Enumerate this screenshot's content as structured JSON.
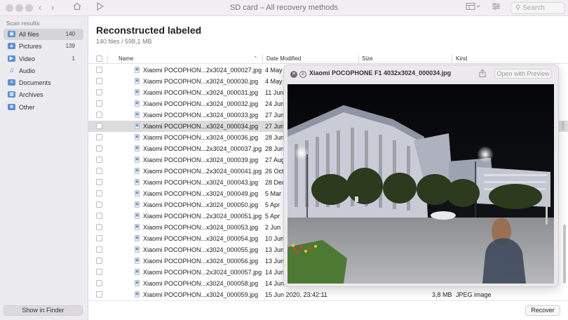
{
  "window": {
    "title": "SD card – All recovery methods",
    "search_placeholder": "Search"
  },
  "sidebar": {
    "section": "Scan results",
    "items": [
      {
        "label": "All files",
        "count": "140",
        "icon": "all-files-icon",
        "selected": true
      },
      {
        "label": "Pictures",
        "count": "139",
        "icon": "pictures-icon"
      },
      {
        "label": "Video",
        "count": "1",
        "icon": "video-icon"
      },
      {
        "label": "Audio",
        "count": "",
        "icon": "audio-icon"
      },
      {
        "label": "Documents",
        "count": "",
        "icon": "documents-icon"
      },
      {
        "label": "Archives",
        "count": "",
        "icon": "archives-icon"
      },
      {
        "label": "Other",
        "count": "",
        "icon": "other-icon"
      }
    ],
    "finder_button": "Show in Finder"
  },
  "main": {
    "heading": "Reconstructed labeled",
    "subheading": "140 files / 598,1 MB",
    "columns": {
      "name": "Name",
      "date": "Date Modified",
      "size": "Size",
      "kind": "Kind"
    },
    "rows": [
      {
        "name": "Xiaomi POCOPHON...2x3024_000027.jpg",
        "date": "4 May",
        "size": "",
        "kind": ""
      },
      {
        "name": "Xiaomi POCOPHON...x3024_000030.jpg",
        "date": "4 May",
        "size": "",
        "kind": ""
      },
      {
        "name": "Xiaomi POCOPHON...x3024_000031.jpg",
        "date": "11 Jun",
        "size": "",
        "kind": ""
      },
      {
        "name": "Xiaomi POCOPHON...x3024_000032.jpg",
        "date": "24 Jun",
        "size": "",
        "kind": ""
      },
      {
        "name": "Xiaomi POCOPHON...x3024_000033.jpg",
        "date": "27 Jun",
        "size": "",
        "kind": ""
      },
      {
        "name": "Xiaomi POCOPHON...x3024_000034.jpg",
        "date": "27 Jun",
        "size": "",
        "kind": "",
        "selected": true
      },
      {
        "name": "Xiaomi POCOPHON...x3024_000036.jpg",
        "date": "28 Jun",
        "size": "",
        "kind": ""
      },
      {
        "name": "Xiaomi POCOPHON...2x3024_000037.jpg",
        "date": "28 Jun",
        "size": "",
        "kind": ""
      },
      {
        "name": "Xiaomi POCOPHON...x3024_000039.jpg",
        "date": "27 Aug",
        "size": "",
        "kind": ""
      },
      {
        "name": "Xiaomi POCOPHON...2x3024_000041.jpg",
        "date": "26 Oct",
        "size": "",
        "kind": ""
      },
      {
        "name": "Xiaomi POCOPHON...x3024_000043.jpg",
        "date": "28 Dec",
        "size": "",
        "kind": ""
      },
      {
        "name": "Xiaomi POCOPHON...x3024_000049.jpg",
        "date": "5 Mar",
        "size": "",
        "kind": ""
      },
      {
        "name": "Xiaomi POCOPHON...x3024_000050.jpg",
        "date": "5 Apr",
        "size": "",
        "kind": ""
      },
      {
        "name": "Xiaomi POCOPHON...2x3024_000051.jpg",
        "date": "5 Apr",
        "size": "",
        "kind": ""
      },
      {
        "name": "Xiaomi POCOPHON...x3024_000053.jpg",
        "date": "2 Jun",
        "size": "",
        "kind": ""
      },
      {
        "name": "Xiaomi POCOPHON...x3024_000054.jpg",
        "date": "10 Jun",
        "size": "",
        "kind": ""
      },
      {
        "name": "Xiaomi POCOPHON...x3024_000055.jpg",
        "date": "13 Jun",
        "size": "",
        "kind": ""
      },
      {
        "name": "Xiaomi POCOPHON...x3024_000056.jpg",
        "date": "13 Jun",
        "size": "",
        "kind": ""
      },
      {
        "name": "Xiaomi POCOPHON...2x3024_000057.jpg",
        "date": "14 Jun",
        "size": "",
        "kind": ""
      },
      {
        "name": "Xiaomi POCOPHON...x3024_000058.jpg",
        "date": "14 Jun",
        "size": "",
        "kind": ""
      },
      {
        "name": "Xiaomi POCOPHON...x3024_000059.jpg",
        "date": "15 Jun 2020, 23:42:11",
        "size": "3,8 MB",
        "kind": "JPEG image"
      }
    ],
    "recover_button": "Recover"
  },
  "preview": {
    "title": "Xiaomi POCOPHONE F1 4032x3024_000034.jpg",
    "open_button": "Open with Preview"
  },
  "colors": {
    "accent": "#5a91d7",
    "selection": "#dcdcdc"
  }
}
